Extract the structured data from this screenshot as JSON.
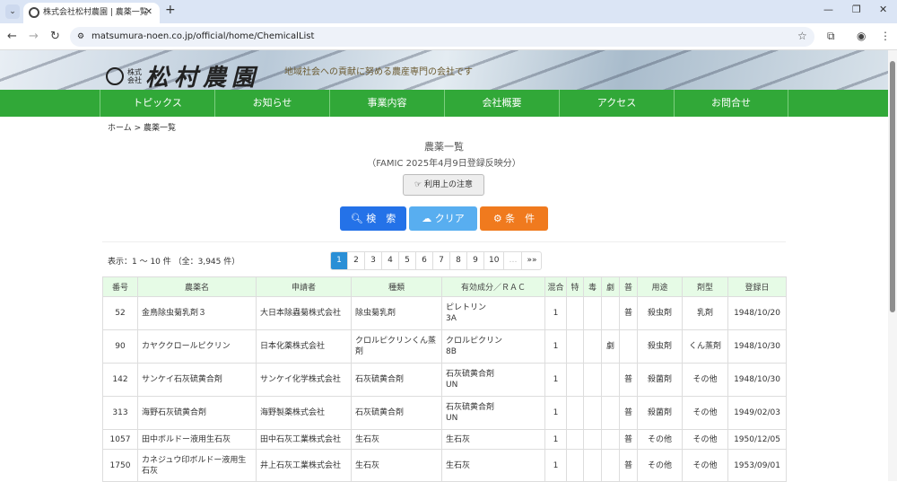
{
  "browser": {
    "tab_title": "株式会社松村農園 | 農薬一覧",
    "url": "matsumura-noen.co.jp/official/home/ChemicalList"
  },
  "header": {
    "company_prefix": "株式会社",
    "company_name": "松村農園",
    "slogan": "地域社会への貢献に努める農産専門の会社です"
  },
  "nav": [
    "トピックス",
    "お知らせ",
    "事業内容",
    "会社概要",
    "アクセス",
    "お問合せ"
  ],
  "breadcrumb": "ホーム > 農薬一覧",
  "page": {
    "title": "農薬一覧",
    "subtitle": "（FAMIC 2025年4月9日登録反映分）",
    "notice_label": "利用上の注意"
  },
  "buttons": {
    "search": "検　索",
    "clear": "クリア",
    "conditions": "条　件"
  },
  "colors": {
    "search": "#2472e8",
    "clear": "#58aef0",
    "conditions": "#f07a1e",
    "nav": "#31a838"
  },
  "count_text": "表示：1 ～ 10 件 （全：3,945 件）",
  "pagination": {
    "pages": [
      "1",
      "2",
      "3",
      "4",
      "5",
      "6",
      "7",
      "8",
      "9",
      "10"
    ],
    "ellipsis": "…",
    "last": "»»",
    "current": "1"
  },
  "table": {
    "headers": [
      "番号",
      "農薬名",
      "申請者",
      "種類",
      "有効成分／ＲＡＣ",
      "混合",
      "特",
      "毒",
      "劇",
      "普",
      "用途",
      "剤型",
      "登録日"
    ],
    "rows": [
      [
        "52",
        "金鳥除虫菊乳剤３",
        "大日本除蟲菊株式会社",
        "除虫菊乳剤",
        "ピレトリン",
        "3A",
        "1",
        "",
        "",
        "",
        "普",
        "殺虫剤",
        "乳剤",
        "1948/10/20"
      ],
      [
        "90",
        "カヤククロールピクリン",
        "日本化薬株式会社",
        "クロルピクリンくん蒸剤",
        "クロルピクリン",
        "8B",
        "1",
        "",
        "",
        "劇",
        "",
        "殺虫剤",
        "くん蒸剤",
        "1948/10/30"
      ],
      [
        "142",
        "サンケイ石灰硫黄合剤",
        "サンケイ化学株式会社",
        "石灰硫黄合剤",
        "石灰硫黄合剤",
        "UN",
        "1",
        "",
        "",
        "",
        "普",
        "殺菌剤",
        "その他",
        "1948/10/30"
      ],
      [
        "313",
        "海野石灰硫黄合剤",
        "海野製薬株式会社",
        "石灰硫黄合剤",
        "石灰硫黄合剤",
        "UN",
        "1",
        "",
        "",
        "",
        "普",
        "殺菌剤",
        "その他",
        "1949/02/03"
      ],
      [
        "1057",
        "田中ボルドー液用生石灰",
        "田中石灰工業株式会社",
        "生石灰",
        "生石灰",
        "",
        "1",
        "",
        "",
        "",
        "普",
        "その他",
        "その他",
        "1950/12/05"
      ],
      [
        "1750",
        "カネジュウ印ボルドー液用生石灰",
        "井上石灰工業株式会社",
        "生石灰",
        "生石灰",
        "",
        "1",
        "",
        "",
        "",
        "普",
        "その他",
        "その他",
        "1953/09/01"
      ]
    ]
  }
}
